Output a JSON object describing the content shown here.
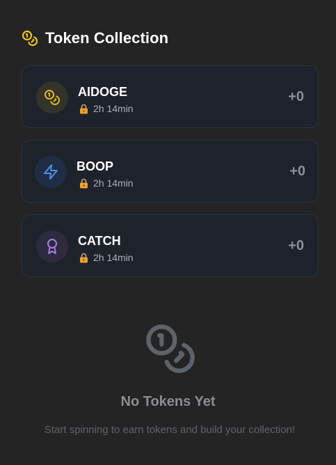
{
  "header": {
    "title": "Token Collection",
    "icon": "coins-icon",
    "icon_color": "#e8c321"
  },
  "tokens": [
    {
      "name": "AIDOGE",
      "lock_text": "2h 14min",
      "value": "+0",
      "icon": "coins-icon",
      "icon_color": "#e0b820",
      "icon_bg": "#33332a"
    },
    {
      "name": "BOOP",
      "lock_text": "2h 14min",
      "value": "+0",
      "icon": "lightning-icon",
      "icon_color": "#4f8fe6",
      "icon_bg": "#1f2e45"
    },
    {
      "name": "CATCH",
      "lock_text": "2h 14min",
      "value": "+0",
      "icon": "award-icon",
      "icon_color": "#a77ee0",
      "icon_bg": "#2e2a40"
    }
  ],
  "empty_state": {
    "icon": "coins-icon",
    "title": "No Tokens Yet",
    "subtitle": "Start spinning to earn tokens and build your collection!"
  },
  "colors": {
    "background": "#242424",
    "card_bg": "#1e232b",
    "lock": "#f0a030"
  }
}
